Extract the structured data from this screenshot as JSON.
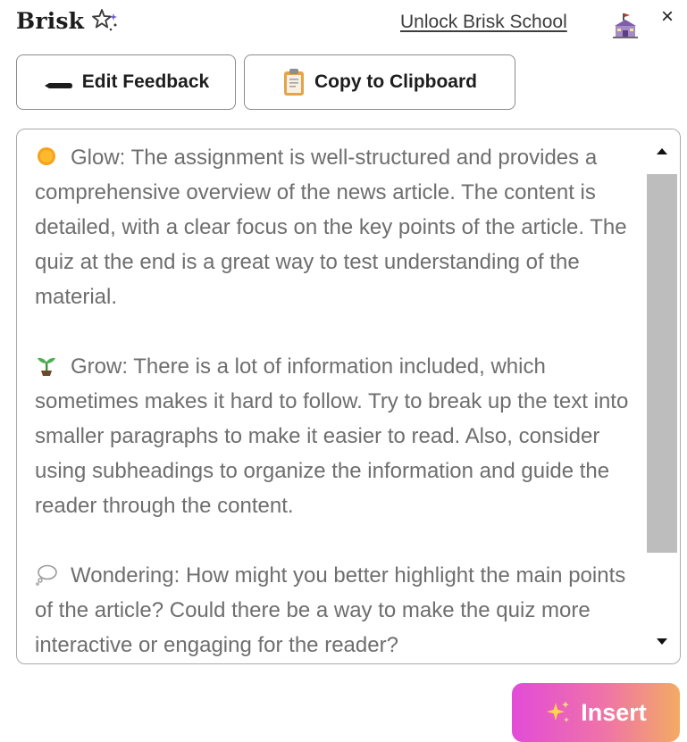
{
  "header": {
    "brand_name": "Brisk",
    "unlock_link": "Unlock Brisk School",
    "close_glyph": "×",
    "icons": [
      "sparkle-stars-icon",
      "school-icon",
      "close-icon"
    ]
  },
  "toolbar": {
    "edit_label": "Edit Feedback",
    "copy_label": "Copy to Clipboard",
    "icons": [
      "pen-icon",
      "clipboard-icon"
    ]
  },
  "feedback": {
    "glow": "Glow: The assignment is well-structured and provides a comprehensive overview of the news article. The content is detailed, with a clear focus on the key points of the article. The quiz at the end is a great way to test understanding of the material.",
    "grow": "Grow: There is a lot of information included, which sometimes makes it hard to follow. Try to break up the text into smaller paragraphs to make it easier to read. Also, consider using subheadings to organize the information and guide the reader through the content.",
    "wondering": "Wondering: How might you better highlight the main points of the article? Could there be a way to make the quiz more interactive or engaging for the reader?",
    "icons": [
      "sun-icon",
      "seedling-icon",
      "thought-bubble-icon"
    ]
  },
  "insert": {
    "label": "Insert",
    "icon": "sparkles-icon"
  },
  "colors": {
    "text": "#6e6e6e",
    "border": "#8b8b8b",
    "scroll_thumb": "#bdbdbd",
    "insert_gradient_start": "#e24bd8",
    "insert_gradient_end": "#f3ab63"
  }
}
